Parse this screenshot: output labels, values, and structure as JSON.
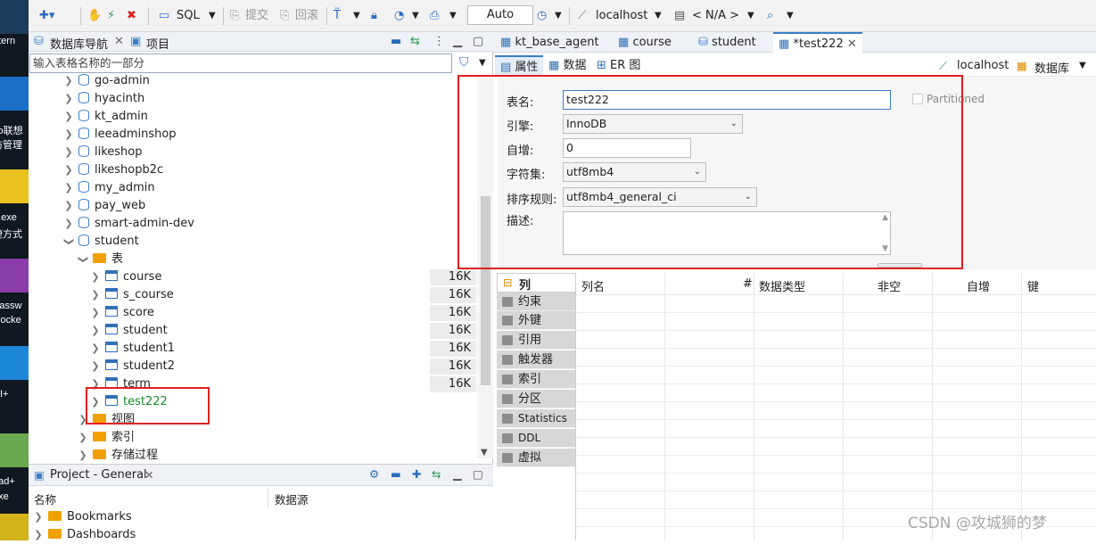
{
  "desktop": {
    "labels": [
      "ntern",
      "vo联想",
      "访管理",
      "n.exe",
      "捷方式",
      "Passw",
      "nlocke",
      "UI+",
      "oad+",
      "exe"
    ]
  },
  "toolbar": {
    "sql_label": "SQL",
    "commit_label": "提交",
    "rollback_label": "回滚",
    "auto_label": "Auto",
    "connection_label": "localhost",
    "schema_label": "< N/A >"
  },
  "left_panel": {
    "tab_navigator": "数据库导航",
    "tab_project": "项目",
    "filter_placeholder": "输入表格名称的一部分",
    "databases": [
      "go-admin",
      "hyacinth",
      "kt_admin",
      "leeadminshop",
      "likeshop",
      "likeshopb2c",
      "my_admin",
      "pay_web",
      "smart-admin-dev",
      "student"
    ],
    "folder_tables": "表",
    "tables": [
      {
        "name": "course",
        "size": "16K"
      },
      {
        "name": "s_course",
        "size": "16K"
      },
      {
        "name": "score",
        "size": "16K"
      },
      {
        "name": "student",
        "size": "16K"
      },
      {
        "name": "student1",
        "size": "16K"
      },
      {
        "name": "student2",
        "size": "16K"
      },
      {
        "name": "term",
        "size": "16K"
      }
    ],
    "new_table": "test222",
    "folder_views": "视图",
    "folder_indexes": "索引",
    "folder_procs": "存储过程"
  },
  "bottom_panel": {
    "title": "Project - General",
    "col_name": "名称",
    "col_source": "数据源",
    "items": [
      "Bookmarks",
      "Dashboards"
    ]
  },
  "editor": {
    "tabs": [
      "kt_base_agent",
      "course",
      "student",
      "*test222"
    ],
    "subtabs": [
      "属性",
      "数据",
      "ER 图"
    ],
    "conn_label": "localhost",
    "db_label": "数据库"
  },
  "form": {
    "name_label": "表名:",
    "name_value": "test222",
    "partitioned_label": "Partitioned",
    "engine_label": "引擎:",
    "engine_value": "InnoDB",
    "autoinc_label": "自增:",
    "autoinc_value": "0",
    "charset_label": "字符集:",
    "charset_value": "utf8mb4",
    "collation_label": "排序规则:",
    "collation_value": "utf8mb4_general_ci",
    "desc_label": "描述:"
  },
  "columns_panel": {
    "side_tabs": [
      "列",
      "约束",
      "外键",
      "引用",
      "触发器",
      "索引",
      "分区",
      "Statistics",
      "DDL",
      "虚拟"
    ],
    "headers": [
      "列名",
      "#",
      "数据类型",
      "非空",
      "自增",
      "键"
    ]
  },
  "watermark": "CSDN @攻城狮的梦"
}
